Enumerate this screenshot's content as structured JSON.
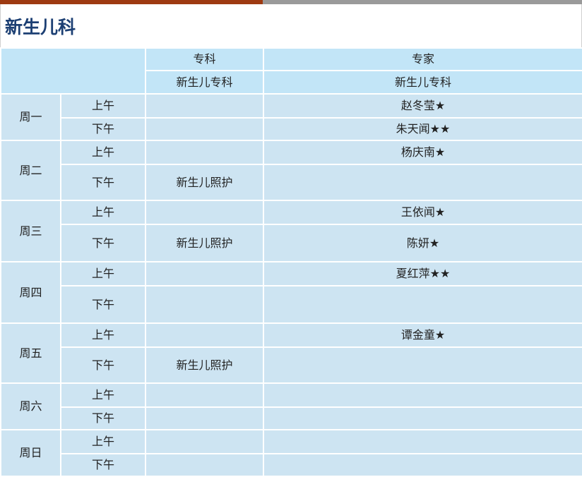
{
  "header": {
    "title": "新生儿科",
    "bar_color_left": "#9e3a12",
    "bar_color_right": "#9a9a9a",
    "title_color": "#1c3f73"
  },
  "table": {
    "head_color": "#c2e5f7",
    "body_color": "#cde4f2",
    "col_specialty": "专科",
    "col_expert": "专家",
    "sub_specialty": "新生儿专科",
    "sub_expert": "新生儿专科",
    "days": [
      {
        "day": "周一",
        "am": {
          "label": "上午",
          "specialty": "",
          "expert": "赵冬莹★"
        },
        "pm": {
          "label": "下午",
          "specialty": "",
          "expert": "朱天闻★★"
        }
      },
      {
        "day": "周二",
        "am": {
          "label": "上午",
          "specialty": "",
          "expert": "杨庆南★"
        },
        "pm": {
          "label": "下午",
          "specialty": "新生儿照护",
          "expert": ""
        }
      },
      {
        "day": "周三",
        "am": {
          "label": "上午",
          "specialty": "",
          "expert": "王依闻★"
        },
        "pm": {
          "label": "下午",
          "specialty": "新生儿照护",
          "expert": "陈妍★"
        }
      },
      {
        "day": "周四",
        "am": {
          "label": "上午",
          "specialty": "",
          "expert": "夏红萍★★"
        },
        "pm": {
          "label": "下午",
          "specialty": "",
          "expert": ""
        }
      },
      {
        "day": "周五",
        "am": {
          "label": "上午",
          "specialty": "",
          "expert": "谭金童★"
        },
        "pm": {
          "label": "下午",
          "specialty": "新生儿照护",
          "expert": ""
        }
      },
      {
        "day": "周六",
        "am": {
          "label": "上午",
          "specialty": "",
          "expert": ""
        },
        "pm": {
          "label": "下午",
          "specialty": "",
          "expert": ""
        }
      },
      {
        "day": "周日",
        "am": {
          "label": "上午",
          "specialty": "",
          "expert": ""
        },
        "pm": {
          "label": "下午",
          "specialty": "",
          "expert": ""
        }
      }
    ]
  }
}
